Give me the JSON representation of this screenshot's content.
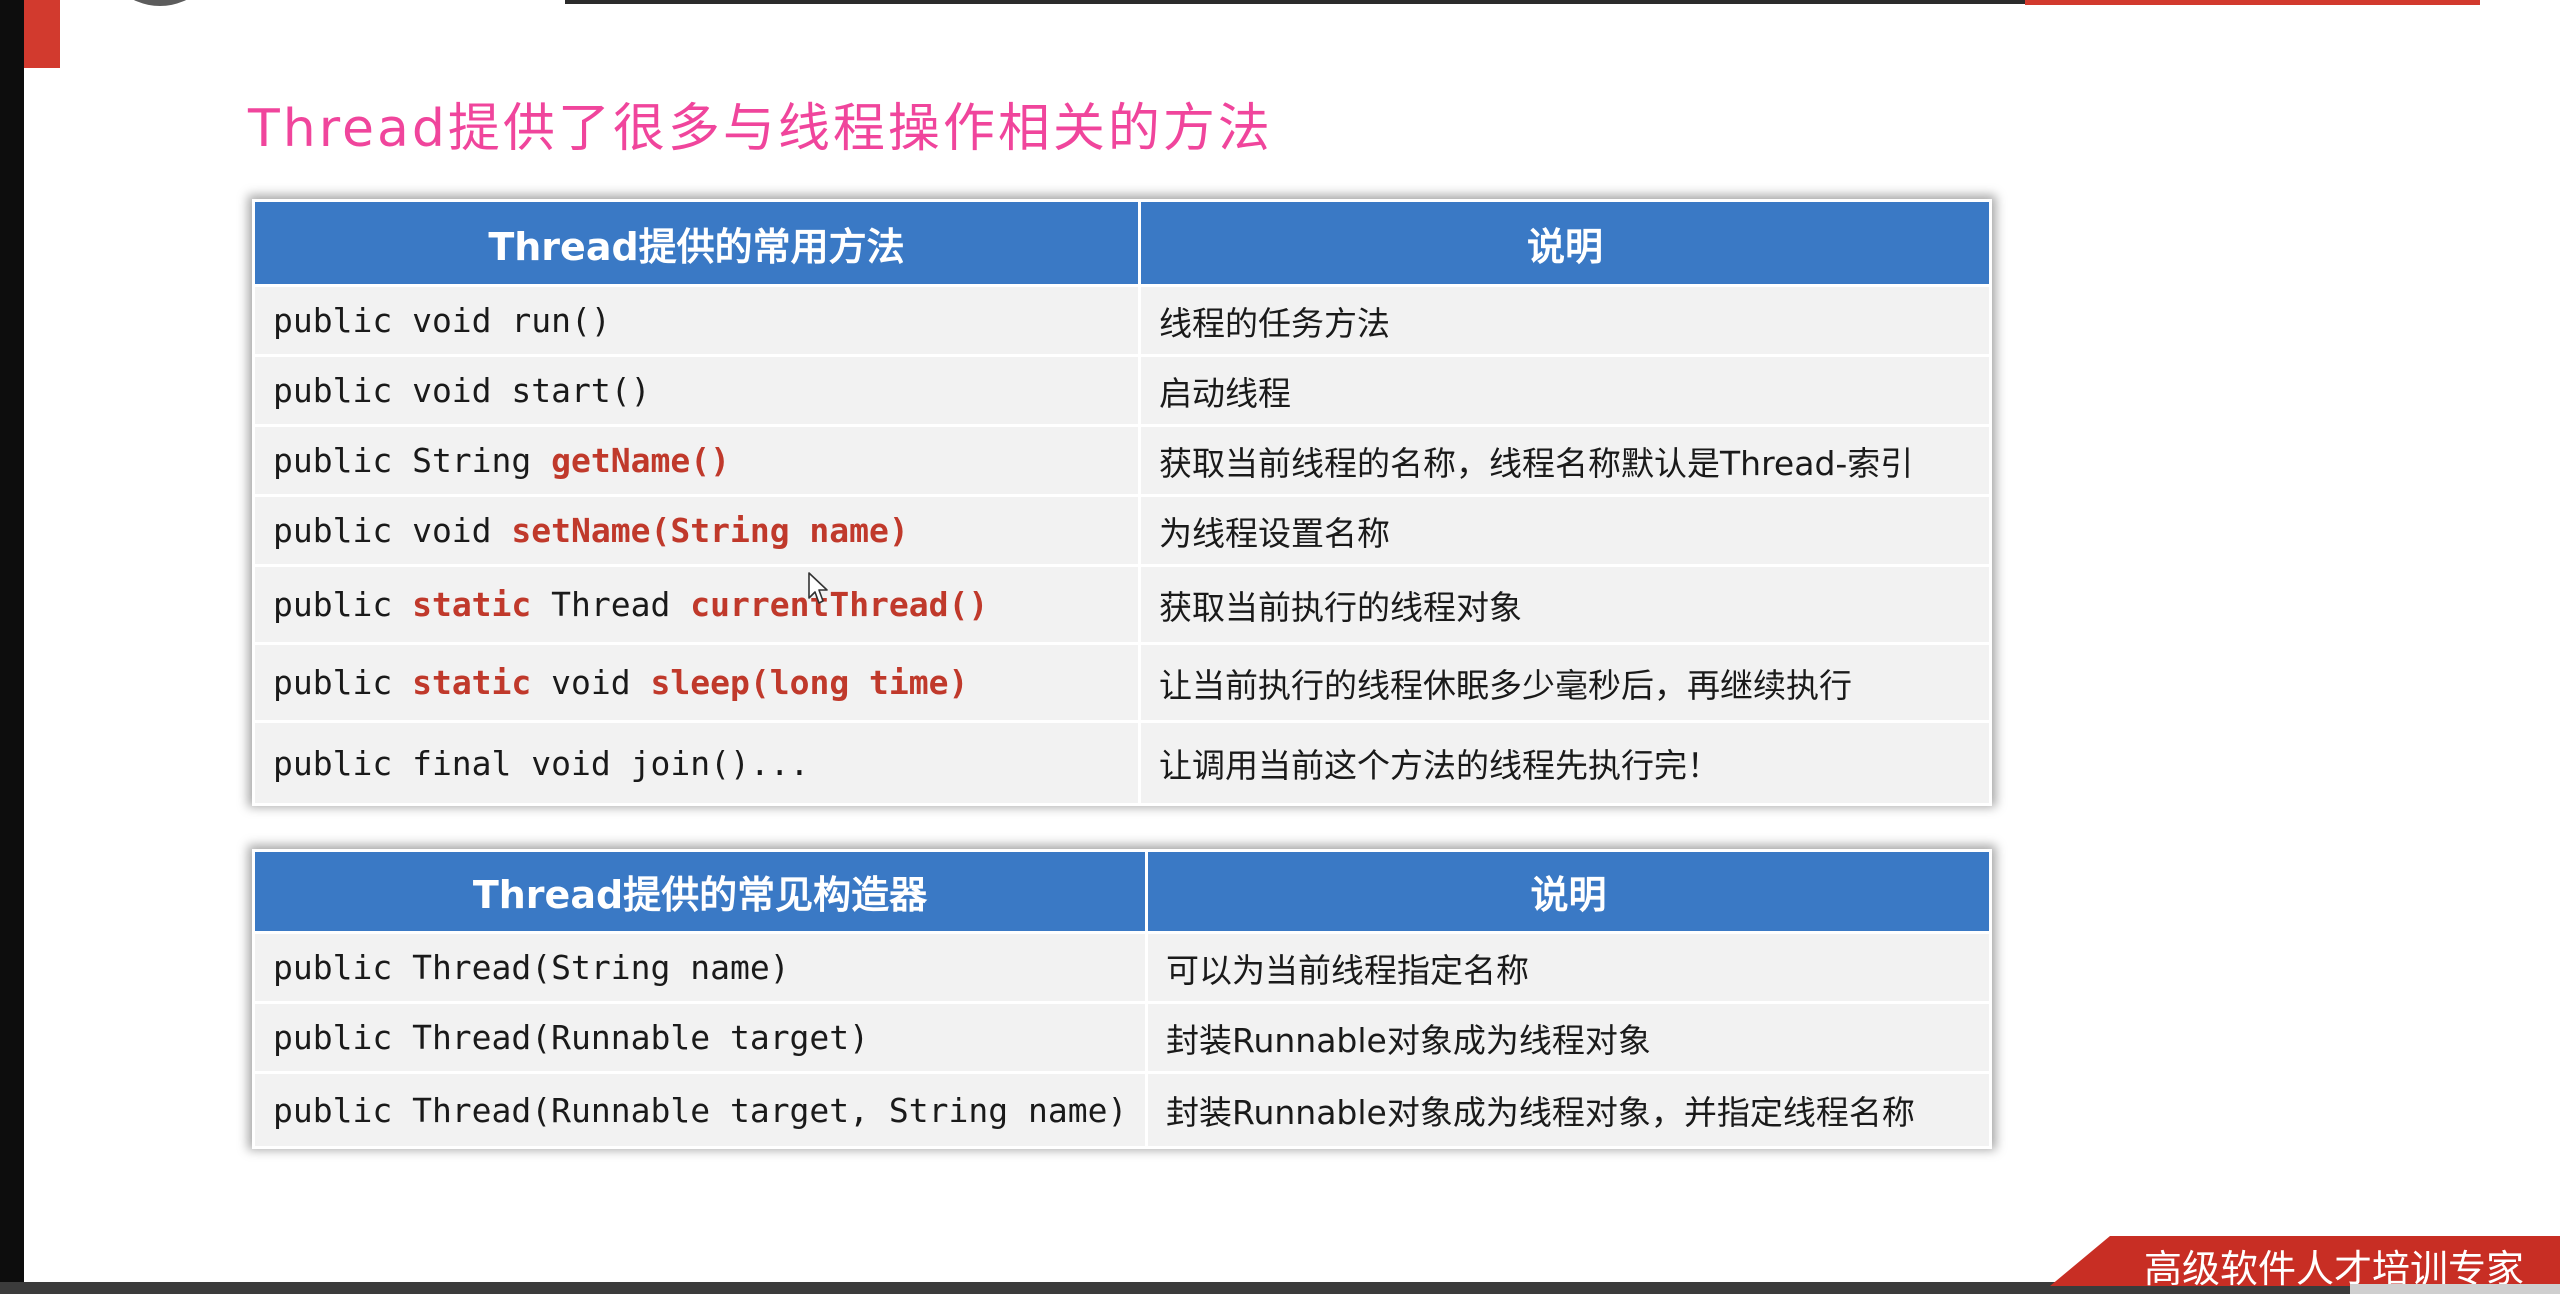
{
  "slide": {
    "title": "Thread提供了很多与线程操作相关的方法",
    "footer_slogan": "高级软件人才培训专家"
  },
  "methods_table": {
    "headers": [
      "Thread提供的常用方法",
      "说明"
    ],
    "rows": [
      {
        "plain1": "public void run()",
        "kw1": "",
        "plain2": "",
        "kw2": "",
        "desc": "线程的任务方法"
      },
      {
        "plain1": "public void start()",
        "kw1": "",
        "plain2": "",
        "kw2": "",
        "desc": "启动线程"
      },
      {
        "plain1": "public String ",
        "kw1": "getName()",
        "plain2": "",
        "kw2": "",
        "desc": "获取当前线程的名称，线程名称默认是Thread-索引"
      },
      {
        "plain1": "public void ",
        "kw1": "setName(String name)",
        "plain2": "",
        "kw2": "",
        "desc": "为线程设置名称"
      },
      {
        "plain1": "public ",
        "kw1": "static",
        "plain2": " Thread ",
        "kw2": "currentThread()",
        "desc": "获取当前执行的线程对象"
      },
      {
        "plain1": "public ",
        "kw1": "static",
        "plain2": " void ",
        "kw2": "sleep(long time)",
        "desc": "让当前执行的线程休眠多少毫秒后，再继续执行"
      },
      {
        "plain1": "public final void join()...",
        "kw1": "",
        "plain2": "",
        "kw2": "",
        "desc": "让调用当前这个方法的线程先执行完！"
      }
    ]
  },
  "constructors_table": {
    "headers": [
      "Thread提供的常见构造器",
      "说明"
    ],
    "rows": [
      {
        "code": "public Thread(String name)",
        "desc": "可以为当前线程指定名称"
      },
      {
        "code": "public Thread(Runnable target)",
        "desc": "封装Runnable对象成为线程对象"
      },
      {
        "code": "public Thread(Runnable target, String name)",
        "desc": "封装Runnable对象成为线程对象，并指定线程名称"
      }
    ]
  },
  "colors": {
    "title": "#f0459c",
    "header_bg": "#3a79c5",
    "keyword": "#c0392b",
    "brand_red": "#d23a2e"
  }
}
